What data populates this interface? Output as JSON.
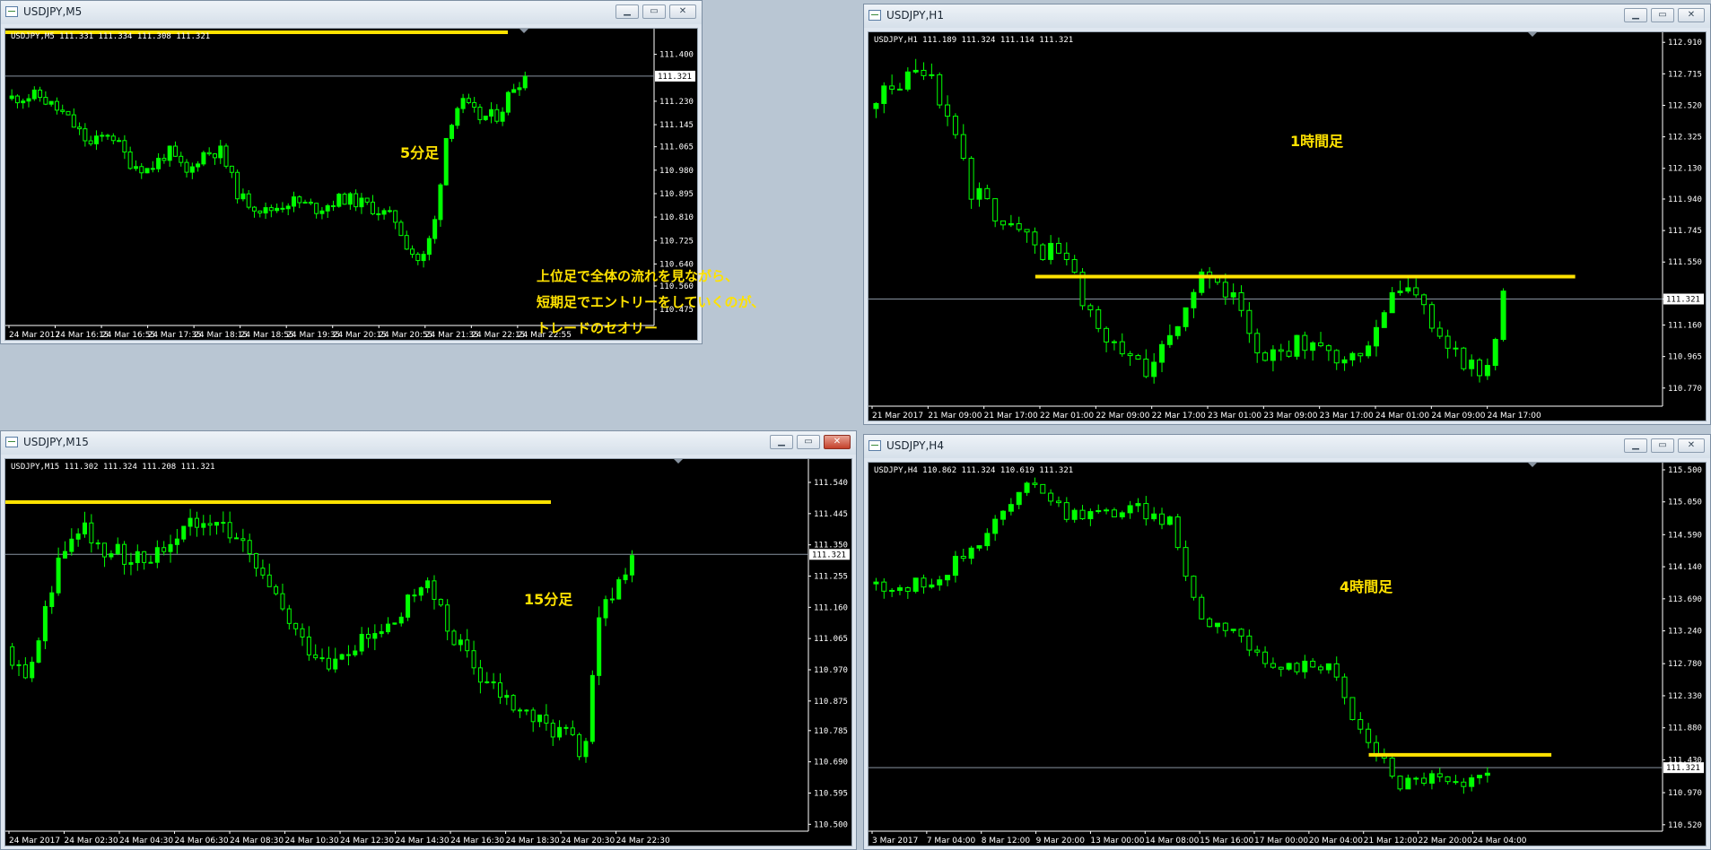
{
  "windows": {
    "m5": {
      "title": "USDJPY,M5",
      "info": "USDJPY,M5 111.331 111.334 111.308 111.321",
      "annotation": "5分足",
      "note": [
        "上位足で全体の流れを見ながら、",
        "短期足でエントリーをしていくのが、",
        "トレードのセオリー"
      ]
    },
    "h1": {
      "title": "USDJPY,H1",
      "info": "USDJPY,H1  111.189 111.324 111.114 111.321",
      "annotation": "1時間足"
    },
    "m15": {
      "title": "USDJPY,M15",
      "info": "USDJPY,M15  111.302 111.324 111.208 111.321",
      "annotation": "15分足"
    },
    "h4": {
      "title": "USDJPY,H4",
      "info": "USDJPY,H4  110.862 111.324 110.619 111.321",
      "annotation": "4時間足"
    }
  },
  "window_buttons": {
    "minimize": "▁",
    "restore": "▭",
    "close": "✕"
  },
  "colors": {
    "bull": "#00ff00",
    "bear_body": "#000000",
    "wick": "#00ff00",
    "resistance": "#ffe200",
    "price_line": "#8893a0",
    "background": "#000000",
    "axis_text": "#ffffff"
  },
  "chart_data": [
    {
      "id": "m5",
      "type": "candlestick",
      "symbol": "USDJPY",
      "timeframe": "M5",
      "last_price": 111.321,
      "ylim": [
        110.43,
        111.48
      ],
      "y_ticks": [
        111.4,
        111.23,
        111.145,
        111.065,
        110.98,
        110.895,
        110.81,
        110.725,
        110.64,
        110.56,
        110.475
      ],
      "y_tick_labels": [
        "111.400",
        "111.230",
        "111.145",
        "111.065",
        "110.980",
        "110.895",
        "110.810",
        "110.725",
        "110.640",
        "110.560",
        "110.475"
      ],
      "x_tick_labels": [
        "24 Mar 2017",
        "24 Mar 16:15",
        "24 Mar 16:55",
        "24 Mar 17:35",
        "24 Mar 18:15",
        "24 Mar 18:55",
        "24 Mar 19:35",
        "24 Mar 20:15",
        "24 Mar 20:55",
        "24 Mar 21:35",
        "24 Mar 22:15",
        "24 Mar 22:55"
      ],
      "resistance_level": 111.48,
      "close_path": [
        [
          0,
          111.24
        ],
        [
          0.05,
          111.25
        ],
        [
          0.09,
          111.18
        ],
        [
          0.13,
          111.07
        ],
        [
          0.16,
          111.12
        ],
        [
          0.19,
          111.01
        ],
        [
          0.22,
          110.98
        ],
        [
          0.25,
          111.05
        ],
        [
          0.28,
          110.96
        ],
        [
          0.3,
          111.04
        ],
        [
          0.33,
          111.05
        ],
        [
          0.36,
          110.88
        ],
        [
          0.4,
          110.83
        ],
        [
          0.44,
          110.87
        ],
        [
          0.48,
          110.84
        ],
        [
          0.52,
          110.88
        ],
        [
          0.56,
          110.85
        ],
        [
          0.6,
          110.8
        ],
        [
          0.62,
          110.7
        ],
        [
          0.64,
          110.64
        ],
        [
          0.66,
          110.78
        ],
        [
          0.68,
          111.13
        ],
        [
          0.7,
          111.23
        ],
        [
          0.73,
          111.17
        ],
        [
          0.76,
          111.18
        ],
        [
          0.78,
          111.28
        ],
        [
          0.8,
          111.32
        ]
      ],
      "candle_count": 92,
      "volatility": 0.03
    },
    {
      "id": "h1",
      "type": "candlestick",
      "symbol": "USDJPY",
      "timeframe": "H1",
      "last_price": 111.321,
      "ylim": [
        110.68,
        112.95
      ],
      "y_ticks": [
        112.91,
        112.715,
        112.52,
        112.325,
        112.13,
        111.94,
        111.745,
        111.55,
        111.321,
        111.16,
        110.965,
        110.77,
        110.575
      ],
      "y_tick_labels": [
        "112.910",
        "112.715",
        "112.520",
        "112.325",
        "112.130",
        "111.940",
        "111.745",
        "111.550",
        "111.321",
        "111.160",
        "110.965",
        "110.770",
        "110.575"
      ],
      "x_tick_labels": [
        "21 Mar 2017",
        "21 Mar 09:00",
        "21 Mar 17:00",
        "22 Mar 01:00",
        "22 Mar 09:00",
        "22 Mar 17:00",
        "23 Mar 01:00",
        "23 Mar 09:00",
        "23 Mar 17:00",
        "24 Mar 01:00",
        "24 Mar 09:00",
        "24 Mar 17:00"
      ],
      "resistance_level": 111.46,
      "close_path": [
        [
          0,
          112.5
        ],
        [
          0.03,
          112.66
        ],
        [
          0.07,
          112.74
        ],
        [
          0.1,
          112.5
        ],
        [
          0.13,
          112.0
        ],
        [
          0.16,
          111.85
        ],
        [
          0.19,
          111.72
        ],
        [
          0.22,
          111.62
        ],
        [
          0.25,
          111.58
        ],
        [
          0.28,
          111.2
        ],
        [
          0.31,
          111.0
        ],
        [
          0.35,
          110.9
        ],
        [
          0.39,
          111.2
        ],
        [
          0.42,
          111.45
        ],
        [
          0.46,
          111.3
        ],
        [
          0.5,
          110.95
        ],
        [
          0.54,
          111.05
        ],
        [
          0.58,
          110.95
        ],
        [
          0.62,
          111.0
        ],
        [
          0.66,
          111.35
        ],
        [
          0.69,
          111.4
        ],
        [
          0.72,
          111.05
        ],
        [
          0.75,
          110.95
        ],
        [
          0.78,
          110.85
        ],
        [
          0.8,
          111.32
        ]
      ],
      "candle_count": 80,
      "volatility": 0.08
    },
    {
      "id": "m15",
      "type": "candlestick",
      "symbol": "USDJPY",
      "timeframe": "M15",
      "last_price": 111.321,
      "ylim": [
        110.49,
        111.6
      ],
      "y_ticks": [
        111.54,
        111.445,
        111.35,
        111.255,
        111.16,
        111.065,
        110.97,
        110.875,
        110.785,
        110.69,
        110.595,
        110.5
      ],
      "y_tick_labels": [
        "111.540",
        "111.445",
        "111.350",
        "111.255",
        "111.160",
        "111.065",
        "110.970",
        "110.875",
        "110.785",
        "110.690",
        "110.595",
        "110.500"
      ],
      "x_tick_labels": [
        "24 Mar 2017",
        "24 Mar 02:30",
        "24 Mar 04:30",
        "24 Mar 06:30",
        "24 Mar 08:30",
        "24 Mar 10:30",
        "24 Mar 12:30",
        "24 Mar 14:30",
        "24 Mar 16:30",
        "24 Mar 18:30",
        "24 Mar 20:30",
        "24 Mar 22:30"
      ],
      "resistance_level": 111.48,
      "close_path": [
        [
          0,
          111.04
        ],
        [
          0.03,
          110.95
        ],
        [
          0.06,
          111.25
        ],
        [
          0.09,
          111.4
        ],
        [
          0.13,
          111.33
        ],
        [
          0.17,
          111.3
        ],
        [
          0.21,
          111.38
        ],
        [
          0.25,
          111.45
        ],
        [
          0.29,
          111.36
        ],
        [
          0.33,
          111.2
        ],
        [
          0.37,
          111.05
        ],
        [
          0.41,
          110.99
        ],
        [
          0.45,
          111.06
        ],
        [
          0.49,
          111.12
        ],
        [
          0.52,
          111.25
        ],
        [
          0.55,
          111.1
        ],
        [
          0.59,
          110.95
        ],
        [
          0.63,
          110.86
        ],
        [
          0.67,
          110.8
        ],
        [
          0.7,
          110.77
        ],
        [
          0.72,
          110.7
        ],
        [
          0.74,
          111.13
        ],
        [
          0.76,
          111.22
        ],
        [
          0.78,
          111.32
        ]
      ],
      "candle_count": 95,
      "volatility": 0.04
    },
    {
      "id": "h4",
      "type": "candlestick",
      "symbol": "USDJPY",
      "timeframe": "H4",
      "last_price": 111.321,
      "ylim": [
        110.48,
        115.55
      ],
      "y_ticks": [
        115.5,
        115.05,
        114.59,
        114.14,
        113.69,
        113.24,
        112.78,
        112.33,
        111.88,
        111.43,
        110.97,
        110.52
      ],
      "y_tick_labels": [
        "115.500",
        "115.050",
        "114.590",
        "114.140",
        "113.690",
        "113.240",
        "112.780",
        "112.330",
        "111.880",
        "111.430",
        "110.970",
        "110.520"
      ],
      "x_tick_labels": [
        "3 Mar 2017",
        "7 Mar 04:00",
        "8 Mar 12:00",
        "9 Mar 20:00",
        "13 Mar 00:00",
        "14 Mar 08:00",
        "15 Mar 16:00",
        "17 Mar 00:00",
        "20 Mar 04:00",
        "21 Mar 12:00",
        "22 Mar 20:00",
        "24 Mar 04:00"
      ],
      "resistance_level": 111.5,
      "close_path": [
        [
          0,
          113.9
        ],
        [
          0.05,
          113.85
        ],
        [
          0.09,
          114.0
        ],
        [
          0.13,
          114.4
        ],
        [
          0.17,
          114.9
        ],
        [
          0.21,
          115.35
        ],
        [
          0.25,
          114.9
        ],
        [
          0.3,
          114.9
        ],
        [
          0.34,
          114.95
        ],
        [
          0.38,
          114.75
        ],
        [
          0.42,
          113.4
        ],
        [
          0.46,
          113.3
        ],
        [
          0.5,
          112.7
        ],
        [
          0.54,
          112.75
        ],
        [
          0.58,
          112.8
        ],
        [
          0.61,
          112.0
        ],
        [
          0.64,
          111.55
        ],
        [
          0.67,
          111.1
        ],
        [
          0.71,
          111.2
        ],
        [
          0.75,
          111.0
        ],
        [
          0.78,
          111.32
        ]
      ],
      "candle_count": 78,
      "volatility": 0.12
    }
  ]
}
